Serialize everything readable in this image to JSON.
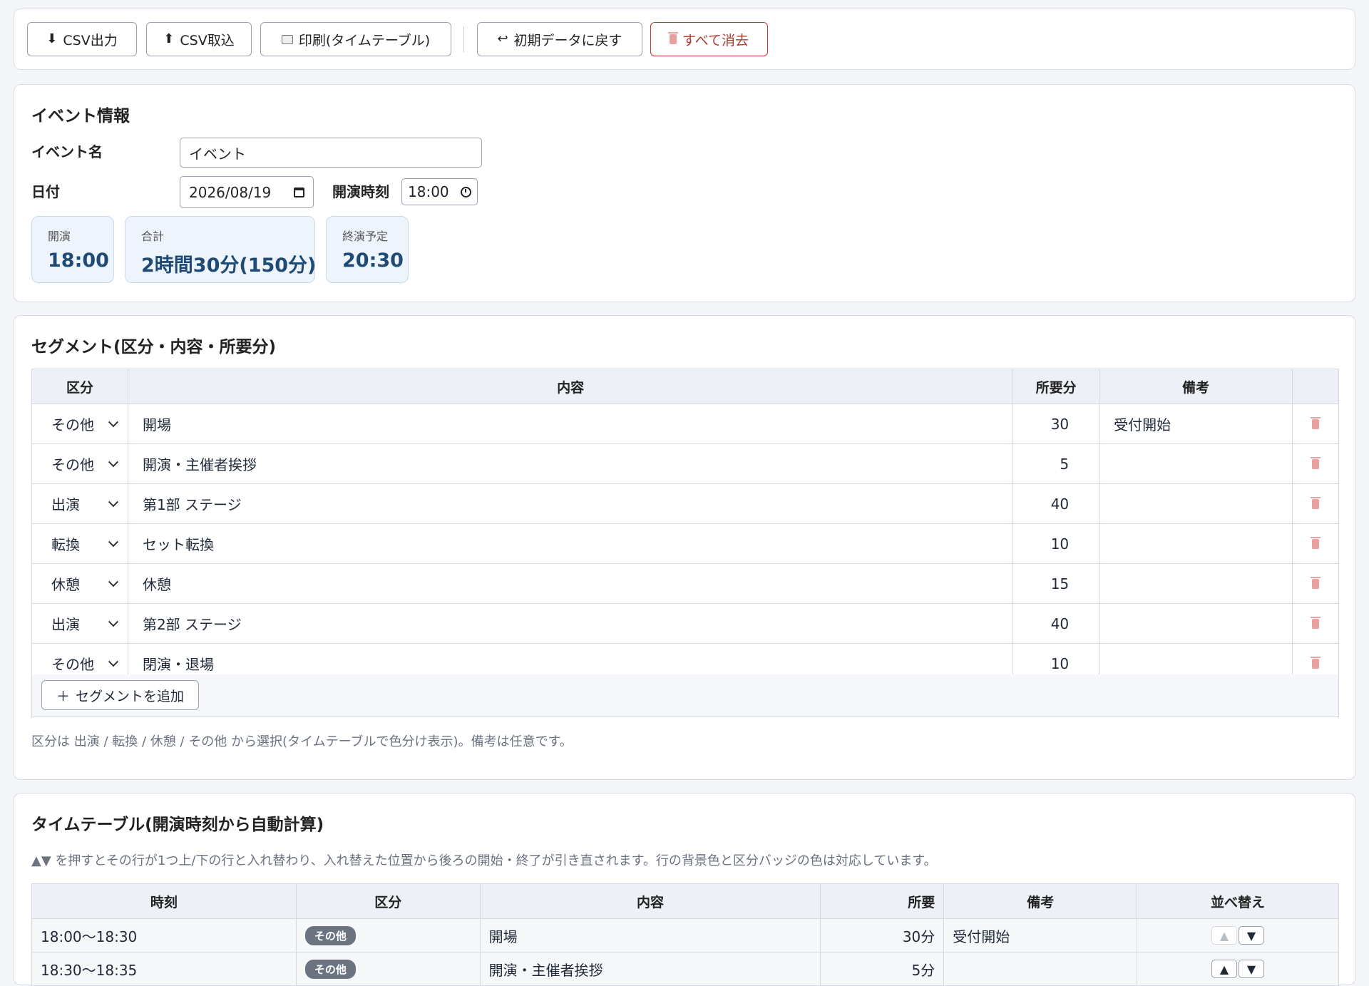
{
  "toolbar": {
    "csv_export": "CSV出力",
    "csv_import": "CSV取込",
    "print": "印刷(タイムテーブル)",
    "reset": "初期データに戻す",
    "clear_all": "すべて消去"
  },
  "event": {
    "heading": "イベント情報",
    "name_label": "イベント名",
    "name_value": "イベント",
    "date_label": "日付",
    "date_value": "2026/08/19",
    "start_label": "開演時刻",
    "start_value": "18:00",
    "stats": [
      {
        "label": "開演",
        "value": "18:00"
      },
      {
        "label": "合計",
        "value": "2時間30分(150分)"
      },
      {
        "label": "終演予定",
        "value": "20:30"
      }
    ]
  },
  "segments": {
    "heading": "セグメント(区分・内容・所要分)",
    "columns": [
      "区分",
      "内容",
      "所要分",
      "備考",
      ""
    ],
    "rows": [
      {
        "category": "その他",
        "content": "開場",
        "minutes": "30",
        "note": "受付開始"
      },
      {
        "category": "その他",
        "content": "開演・主催者挨拶",
        "minutes": "5",
        "note": ""
      },
      {
        "category": "出演",
        "content": "第1部 ステージ",
        "minutes": "40",
        "note": ""
      },
      {
        "category": "転換",
        "content": "セット転換",
        "minutes": "10",
        "note": ""
      },
      {
        "category": "休憩",
        "content": "休憩",
        "minutes": "15",
        "note": ""
      },
      {
        "category": "出演",
        "content": "第2部 ステージ",
        "minutes": "40",
        "note": ""
      },
      {
        "category": "その他",
        "content": "閉演・退場",
        "minutes": "10",
        "note": ""
      }
    ],
    "add_button": "セグメントを追加",
    "hint": "区分は 出演 / 転換 / 休憩 / その他 から選択(タイムテーブルで色分け表示)。備考は任意です。"
  },
  "timetable": {
    "heading": "タイムテーブル(開演時刻から自動計算)",
    "hint": "▲▼ を押すとその行が1つ上/下の行と入れ替わり、入れ替えた位置から後ろの開始・終了が引き直されます。行の背景色と区分バッジの色は対応しています。",
    "columns": [
      "時刻",
      "区分",
      "内容",
      "所要",
      "備考",
      "並べ替え"
    ],
    "rows": [
      {
        "time": "18:00〜18:30",
        "category": "その他",
        "content": "開場",
        "duration": "30分",
        "note": "受付開始"
      },
      {
        "time": "18:30〜18:35",
        "category": "その他",
        "content": "開演・主催者挨拶",
        "duration": "5分",
        "note": ""
      }
    ],
    "up": "▲",
    "down": "▼"
  }
}
